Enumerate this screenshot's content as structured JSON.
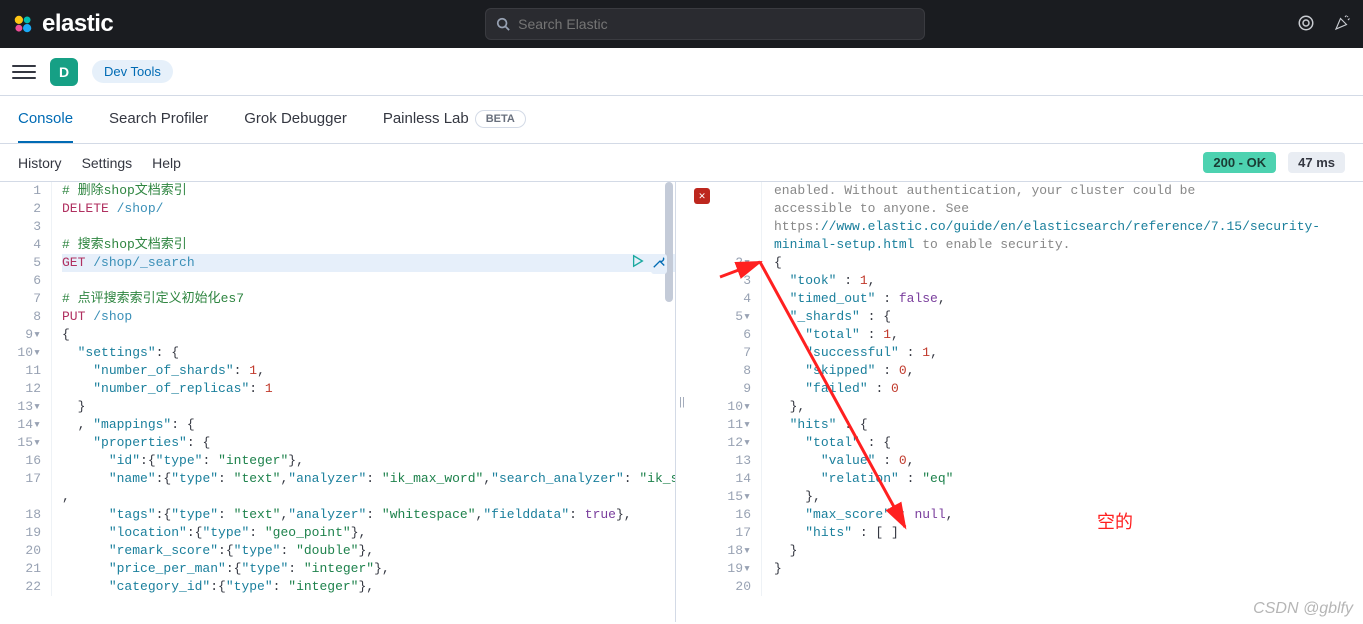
{
  "topbar": {
    "brand": "elastic",
    "search_placeholder": "Search Elastic"
  },
  "header": {
    "avatar_letter": "D",
    "breadcrumb": "Dev Tools"
  },
  "tabs": {
    "items": [
      {
        "label": "Console",
        "active": true
      },
      {
        "label": "Search Profiler",
        "active": false
      },
      {
        "label": "Grok Debugger",
        "active": false
      },
      {
        "label": "Painless Lab",
        "active": false,
        "beta": true
      }
    ],
    "beta_label": "BETA"
  },
  "subbar": {
    "links": [
      "History",
      "Settings",
      "Help"
    ],
    "status": "200 - OK",
    "timing": "47 ms"
  },
  "editor": {
    "lines": [
      {
        "n": 1,
        "tokens": [
          {
            "t": "# 删除shop文档索引",
            "c": "comment"
          }
        ]
      },
      {
        "n": 2,
        "tokens": [
          {
            "t": "DELETE ",
            "c": "method"
          },
          {
            "t": "/shop/",
            "c": "path"
          }
        ]
      },
      {
        "n": 3,
        "tokens": []
      },
      {
        "n": 4,
        "tokens": [
          {
            "t": "# 搜索shop文档索引",
            "c": "comment"
          }
        ]
      },
      {
        "n": 5,
        "tokens": [
          {
            "t": "GET ",
            "c": "method"
          },
          {
            "t": "/shop/_search",
            "c": "path"
          }
        ],
        "active": true
      },
      {
        "n": 6,
        "tokens": []
      },
      {
        "n": 7,
        "tokens": [
          {
            "t": "# 点评搜索索引定义初始化es7",
            "c": "comment"
          }
        ]
      },
      {
        "n": 8,
        "tokens": [
          {
            "t": "PUT ",
            "c": "method"
          },
          {
            "t": "/shop",
            "c": "path"
          }
        ]
      },
      {
        "n": 9,
        "tokens": [
          {
            "t": "{",
            "c": ""
          }
        ],
        "fold": true
      },
      {
        "n": 10,
        "tokens": [
          {
            "t": "  ",
            "c": ""
          },
          {
            "t": "\"settings\"",
            "c": "key"
          },
          {
            "t": ": {",
            "c": ""
          }
        ],
        "fold": true
      },
      {
        "n": 11,
        "tokens": [
          {
            "t": "    ",
            "c": ""
          },
          {
            "t": "\"number_of_shards\"",
            "c": "key"
          },
          {
            "t": ": ",
            "c": ""
          },
          {
            "t": "1",
            "c": "num"
          },
          {
            "t": ",",
            "c": ""
          }
        ]
      },
      {
        "n": 12,
        "tokens": [
          {
            "t": "    ",
            "c": ""
          },
          {
            "t": "\"number_of_replicas\"",
            "c": "key"
          },
          {
            "t": ": ",
            "c": ""
          },
          {
            "t": "1",
            "c": "num"
          }
        ]
      },
      {
        "n": 13,
        "tokens": [
          {
            "t": "  }",
            "c": ""
          }
        ],
        "fold": true
      },
      {
        "n": 14,
        "tokens": [
          {
            "t": "  , ",
            "c": ""
          },
          {
            "t": "\"mappings\"",
            "c": "key"
          },
          {
            "t": ": {",
            "c": ""
          }
        ],
        "fold": true
      },
      {
        "n": 15,
        "tokens": [
          {
            "t": "    ",
            "c": ""
          },
          {
            "t": "\"properties\"",
            "c": "key"
          },
          {
            "t": ": {",
            "c": ""
          }
        ],
        "fold": true
      },
      {
        "n": 16,
        "tokens": [
          {
            "t": "      ",
            "c": ""
          },
          {
            "t": "\"id\"",
            "c": "key"
          },
          {
            "t": ":{",
            "c": ""
          },
          {
            "t": "\"type\"",
            "c": "key"
          },
          {
            "t": ": ",
            "c": ""
          },
          {
            "t": "\"integer\"",
            "c": "str"
          },
          {
            "t": "},",
            "c": ""
          }
        ]
      },
      {
        "n": 17,
        "tokens": [
          {
            "t": "      ",
            "c": ""
          },
          {
            "t": "\"name\"",
            "c": "key"
          },
          {
            "t": ":{",
            "c": ""
          },
          {
            "t": "\"type\"",
            "c": "key"
          },
          {
            "t": ": ",
            "c": ""
          },
          {
            "t": "\"text\"",
            "c": "str"
          },
          {
            "t": ",",
            "c": ""
          },
          {
            "t": "\"analyzer\"",
            "c": "key"
          },
          {
            "t": ": ",
            "c": ""
          },
          {
            "t": "\"ik_max_word\"",
            "c": "str"
          },
          {
            "t": ",",
            "c": ""
          },
          {
            "t": "\"search_analyzer\"",
            "c": "key"
          },
          {
            "t": ": ",
            "c": ""
          },
          {
            "t": "\"ik_smart\"",
            "c": "str"
          },
          {
            "t": "}",
            "c": ""
          }
        ]
      },
      {
        "n": "",
        "tokens": [
          {
            "t": ",",
            "c": ""
          }
        ]
      },
      {
        "n": 18,
        "tokens": [
          {
            "t": "      ",
            "c": ""
          },
          {
            "t": "\"tags\"",
            "c": "key"
          },
          {
            "t": ":{",
            "c": ""
          },
          {
            "t": "\"type\"",
            "c": "key"
          },
          {
            "t": ": ",
            "c": ""
          },
          {
            "t": "\"text\"",
            "c": "str"
          },
          {
            "t": ",",
            "c": ""
          },
          {
            "t": "\"analyzer\"",
            "c": "key"
          },
          {
            "t": ": ",
            "c": ""
          },
          {
            "t": "\"whitespace\"",
            "c": "str"
          },
          {
            "t": ",",
            "c": ""
          },
          {
            "t": "\"fielddata\"",
            "c": "key"
          },
          {
            "t": ": ",
            "c": ""
          },
          {
            "t": "true",
            "c": "bool"
          },
          {
            "t": "},",
            "c": ""
          }
        ]
      },
      {
        "n": 19,
        "tokens": [
          {
            "t": "      ",
            "c": ""
          },
          {
            "t": "\"location\"",
            "c": "key"
          },
          {
            "t": ":{",
            "c": ""
          },
          {
            "t": "\"type\"",
            "c": "key"
          },
          {
            "t": ": ",
            "c": ""
          },
          {
            "t": "\"geo_point\"",
            "c": "str"
          },
          {
            "t": "},",
            "c": ""
          }
        ]
      },
      {
        "n": 20,
        "tokens": [
          {
            "t": "      ",
            "c": ""
          },
          {
            "t": "\"remark_score\"",
            "c": "key"
          },
          {
            "t": ":{",
            "c": ""
          },
          {
            "t": "\"type\"",
            "c": "key"
          },
          {
            "t": ": ",
            "c": ""
          },
          {
            "t": "\"double\"",
            "c": "str"
          },
          {
            "t": "},",
            "c": ""
          }
        ]
      },
      {
        "n": 21,
        "tokens": [
          {
            "t": "      ",
            "c": ""
          },
          {
            "t": "\"price_per_man\"",
            "c": "key"
          },
          {
            "t": ":{",
            "c": ""
          },
          {
            "t": "\"type\"",
            "c": "key"
          },
          {
            "t": ": ",
            "c": ""
          },
          {
            "t": "\"integer\"",
            "c": "str"
          },
          {
            "t": "},",
            "c": ""
          }
        ]
      },
      {
        "n": 22,
        "tokens": [
          {
            "t": "      ",
            "c": ""
          },
          {
            "t": "\"category_id\"",
            "c": "key"
          },
          {
            "t": ":{",
            "c": ""
          },
          {
            "t": "\"type\"",
            "c": "key"
          },
          {
            "t": ": ",
            "c": ""
          },
          {
            "t": "\"integer\"",
            "c": "str"
          },
          {
            "t": "},",
            "c": ""
          }
        ]
      }
    ]
  },
  "response": {
    "pre_text": "enabled. Without authentication, your cluster could be accessible to anyone. See https://www.elastic.co/guide/en/elasticsearch/reference/7.15/security-minimal-setup.html to enable security.",
    "lines": [
      {
        "n": 2,
        "tokens": [
          {
            "t": "{",
            "c": ""
          }
        ],
        "fold": true
      },
      {
        "n": 3,
        "tokens": [
          {
            "t": "  ",
            "c": ""
          },
          {
            "t": "\"took\"",
            "c": "key"
          },
          {
            "t": " : ",
            "c": ""
          },
          {
            "t": "1",
            "c": "num"
          },
          {
            "t": ",",
            "c": ""
          }
        ]
      },
      {
        "n": 4,
        "tokens": [
          {
            "t": "  ",
            "c": ""
          },
          {
            "t": "\"timed_out\"",
            "c": "key"
          },
          {
            "t": " : ",
            "c": ""
          },
          {
            "t": "false",
            "c": "bool"
          },
          {
            "t": ",",
            "c": ""
          }
        ]
      },
      {
        "n": 5,
        "tokens": [
          {
            "t": "  ",
            "c": ""
          },
          {
            "t": "\"_shards\"",
            "c": "key"
          },
          {
            "t": " : {",
            "c": ""
          }
        ],
        "fold": true
      },
      {
        "n": 6,
        "tokens": [
          {
            "t": "    ",
            "c": ""
          },
          {
            "t": "\"total\"",
            "c": "key"
          },
          {
            "t": " : ",
            "c": ""
          },
          {
            "t": "1",
            "c": "num"
          },
          {
            "t": ",",
            "c": ""
          }
        ]
      },
      {
        "n": 7,
        "tokens": [
          {
            "t": "    ",
            "c": ""
          },
          {
            "t": "\"successful\"",
            "c": "key"
          },
          {
            "t": " : ",
            "c": ""
          },
          {
            "t": "1",
            "c": "num"
          },
          {
            "t": ",",
            "c": ""
          }
        ]
      },
      {
        "n": 8,
        "tokens": [
          {
            "t": "    ",
            "c": ""
          },
          {
            "t": "\"skipped\"",
            "c": "key"
          },
          {
            "t": " : ",
            "c": ""
          },
          {
            "t": "0",
            "c": "num"
          },
          {
            "t": ",",
            "c": ""
          }
        ]
      },
      {
        "n": 9,
        "tokens": [
          {
            "t": "    ",
            "c": ""
          },
          {
            "t": "\"failed\"",
            "c": "key"
          },
          {
            "t": " : ",
            "c": ""
          },
          {
            "t": "0",
            "c": "num"
          }
        ]
      },
      {
        "n": 10,
        "tokens": [
          {
            "t": "  },",
            "c": ""
          }
        ],
        "fold": true
      },
      {
        "n": 11,
        "tokens": [
          {
            "t": "  ",
            "c": ""
          },
          {
            "t": "\"hits\"",
            "c": "key"
          },
          {
            "t": " : {",
            "c": ""
          }
        ],
        "fold": true
      },
      {
        "n": 12,
        "tokens": [
          {
            "t": "    ",
            "c": ""
          },
          {
            "t": "\"total\"",
            "c": "key"
          },
          {
            "t": " : {",
            "c": ""
          }
        ],
        "fold": true
      },
      {
        "n": 13,
        "tokens": [
          {
            "t": "      ",
            "c": ""
          },
          {
            "t": "\"value\"",
            "c": "key"
          },
          {
            "t": " : ",
            "c": ""
          },
          {
            "t": "0",
            "c": "num"
          },
          {
            "t": ",",
            "c": ""
          }
        ]
      },
      {
        "n": 14,
        "tokens": [
          {
            "t": "      ",
            "c": ""
          },
          {
            "t": "\"relation\"",
            "c": "key"
          },
          {
            "t": " : ",
            "c": ""
          },
          {
            "t": "\"eq\"",
            "c": "str"
          }
        ]
      },
      {
        "n": 15,
        "tokens": [
          {
            "t": "    },",
            "c": ""
          }
        ],
        "fold": true
      },
      {
        "n": 16,
        "tokens": [
          {
            "t": "    ",
            "c": ""
          },
          {
            "t": "\"max_score\"",
            "c": "key"
          },
          {
            "t": " : ",
            "c": ""
          },
          {
            "t": "null",
            "c": "bool"
          },
          {
            "t": ",",
            "c": ""
          }
        ]
      },
      {
        "n": 17,
        "tokens": [
          {
            "t": "    ",
            "c": ""
          },
          {
            "t": "\"hits\"",
            "c": "key"
          },
          {
            "t": " : [ ]",
            "c": ""
          }
        ]
      },
      {
        "n": 18,
        "tokens": [
          {
            "t": "  }",
            "c": ""
          }
        ],
        "fold": true
      },
      {
        "n": 19,
        "tokens": [
          {
            "t": "}",
            "c": ""
          }
        ],
        "fold": true
      },
      {
        "n": 20,
        "tokens": []
      }
    ]
  },
  "annotation": {
    "text": "空的"
  },
  "watermark": "CSDN @gblfy"
}
